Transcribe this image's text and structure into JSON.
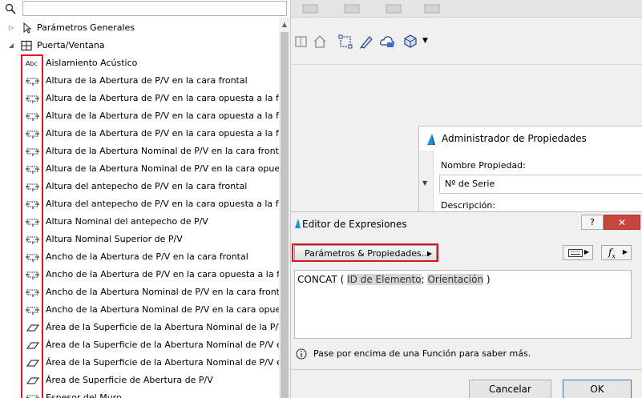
{
  "tree": {
    "search_placeholder": "",
    "group1_label": "Parámetros Generales",
    "group2_label": "Puerta/Ventana",
    "items": [
      {
        "label": "Aislamiento Acústico",
        "icon": "abc-text-icon"
      },
      {
        "label": "Altura de la Abertura de P/V en la cara frontal",
        "icon": "dimension-icon"
      },
      {
        "label": "Altura de la Abertura de P/V en la cara opuesta a la front",
        "icon": "dimension-icon"
      },
      {
        "label": "Altura de la Abertura de P/V en la cara opuesta a la front",
        "icon": "dimension-icon"
      },
      {
        "label": "Altura de la Abertura de P/V en la cara opuesta a la front",
        "icon": "dimension-icon"
      },
      {
        "label": "Altura de la Abertura Nominal de P/V en la cara frontal",
        "icon": "dimension-icon"
      },
      {
        "label": "Altura de la Abertura Nominal de P/V en la cara opuesta",
        "icon": "dimension-icon"
      },
      {
        "label": "Altura del antepecho de P/V en la cara frontal",
        "icon": "dimension-icon"
      },
      {
        "label": "Altura del antepecho de P/V en la cara opuesta a la front",
        "icon": "dimension-icon"
      },
      {
        "label": "Altura Nominal del antepecho de P/V",
        "icon": "dimension-icon"
      },
      {
        "label": "Altura Nominal Superior de P/V",
        "icon": "dimension-icon"
      },
      {
        "label": "Ancho de la Abertura de P/V en la cara frontal",
        "icon": "dimension-icon"
      },
      {
        "label": "Ancho de la Abertura de P/V en la cara opuesta a la front",
        "icon": "dimension-icon"
      },
      {
        "label": "Ancho de la Abertura Nominal de P/V en la cara frontal",
        "icon": "dimension-icon"
      },
      {
        "label": "Ancho de la Abertura Nominal de P/V en la cara opuesta",
        "icon": "dimension-icon"
      },
      {
        "label": "Área de la Superficie de la Abertura Nominal de la P/V",
        "icon": "area-icon"
      },
      {
        "label": "Área de la Superficie de la Abertura Nominal de P/V en e",
        "icon": "area-icon"
      },
      {
        "label": "Área de la Superficie de la Abertura Nominal de P/V en e",
        "icon": "area-icon"
      },
      {
        "label": "Área de Superficie de Abertura de P/V",
        "icon": "area-icon"
      },
      {
        "label": "Espesor del Muro",
        "icon": "dimension-icon"
      }
    ]
  },
  "property_manager": {
    "title": "Administrador de Propiedades",
    "name_label": "Nombre Propiedad:",
    "name_value": "Nº de Serie",
    "description_label": "Descripción:"
  },
  "expression_editor": {
    "title": "Editor de Expresiones",
    "help_label": "?",
    "close_label": "✕",
    "params_button": "Parámetros & Propiedades...",
    "expr_func": "CONCAT (",
    "expr_token1": "ID de Elemento",
    "expr_sep": ";",
    "expr_token2": "Orientación",
    "expr_close": ")",
    "info_text": "Pase por encima de una Función para saber más.",
    "cancel_label": "Cancelar",
    "ok_label": "OK"
  },
  "colors": {
    "highlight_red": "#e0141e",
    "ok_border": "#2d78d0",
    "close_red": "#c8453c"
  }
}
